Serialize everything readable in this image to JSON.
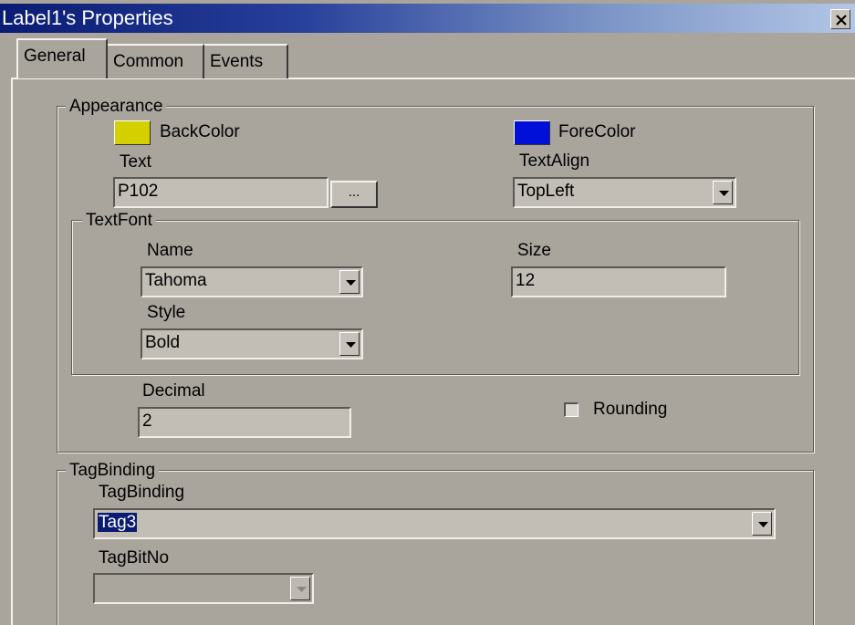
{
  "window": {
    "title": "Label1's Properties",
    "close_icon": "close-icon"
  },
  "tabs": [
    {
      "label": "General",
      "active": true
    },
    {
      "label": "Common",
      "active": false
    },
    {
      "label": "Events",
      "active": false
    }
  ],
  "appearance": {
    "legend": "Appearance",
    "backcolor": {
      "label": "BackColor",
      "color": "#d4d000"
    },
    "forecolor": {
      "label": "ForeColor",
      "color": "#0010d8"
    },
    "text": {
      "label": "Text",
      "value": "P102",
      "browse_label": "..."
    },
    "textalign": {
      "label": "TextAlign",
      "value": "TopLeft"
    },
    "textfont": {
      "legend": "TextFont",
      "name": {
        "label": "Name",
        "value": "Tahoma"
      },
      "size": {
        "label": "Size",
        "value": "12"
      },
      "style": {
        "label": "Style",
        "value": "Bold"
      }
    },
    "decimal": {
      "label": "Decimal",
      "value": "2"
    },
    "rounding": {
      "label": "Rounding",
      "checked": false
    }
  },
  "tagbinding": {
    "legend": "TagBinding",
    "tag": {
      "label": "TagBinding",
      "value": "Tag3"
    },
    "bitno": {
      "label": "TagBitNo",
      "value": ""
    }
  }
}
